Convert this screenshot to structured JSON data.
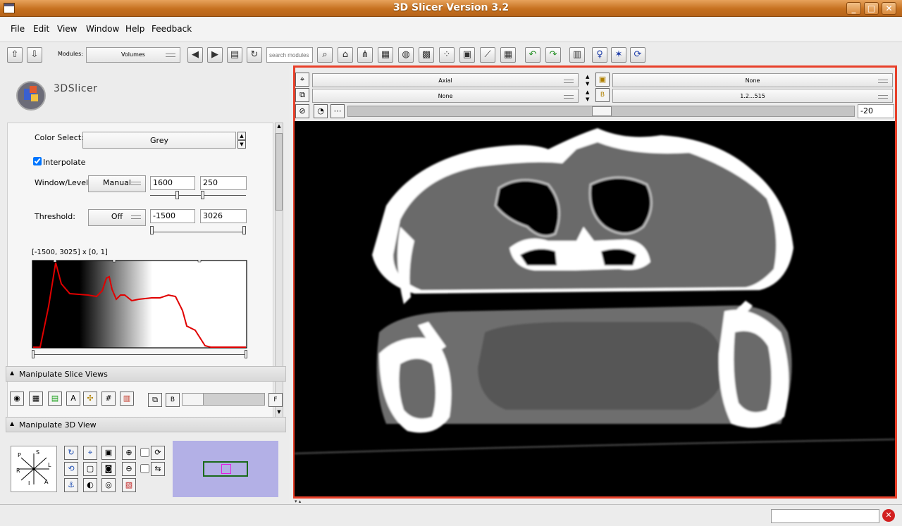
{
  "window": {
    "title": "3D Slicer Version 3.2",
    "minimize_glyph": "_",
    "maximize_glyph": "□",
    "close_glyph": "✕"
  },
  "menu": [
    "File",
    "Edit",
    "View",
    "Window",
    "Help",
    "Feedback"
  ],
  "toolbar": {
    "modules_label": "Modules:",
    "module_value": "Volumes",
    "search_placeholder": "search modules"
  },
  "logo": {
    "text": "3DSlicer"
  },
  "volume_display": {
    "color_select_label": "Color Select:",
    "color_value": "Grey",
    "interpolate_label": "Interpolate",
    "interpolate_checked": true,
    "window_level_label": "Window/Level:",
    "window_level_mode": "Manual",
    "window_value": "1600",
    "level_value": "250",
    "threshold_label": "Threshold:",
    "threshold_mode": "Off",
    "threshold_low": "-1500",
    "threshold_high": "3026",
    "histogram_range": "[-1500, 3025] x [0, 1]"
  },
  "sections": {
    "slice_views": "Manipulate Slice Views",
    "view3d": "Manipulate 3D View"
  },
  "orientation": {
    "P": "P",
    "S": "S",
    "R": "R",
    "L": "L",
    "I": "I",
    "A": "A"
  },
  "slice_controls": {
    "orientation": "Axial",
    "fg_volume": "None",
    "label_volume": "None",
    "bg_volume": "1.2...515",
    "offset_value": "-20"
  },
  "colors": {
    "accent_red": "#e8402a",
    "title_orange": "#c5701f",
    "curve_red": "#e00000",
    "nav_bg": "#b3b0e6"
  }
}
